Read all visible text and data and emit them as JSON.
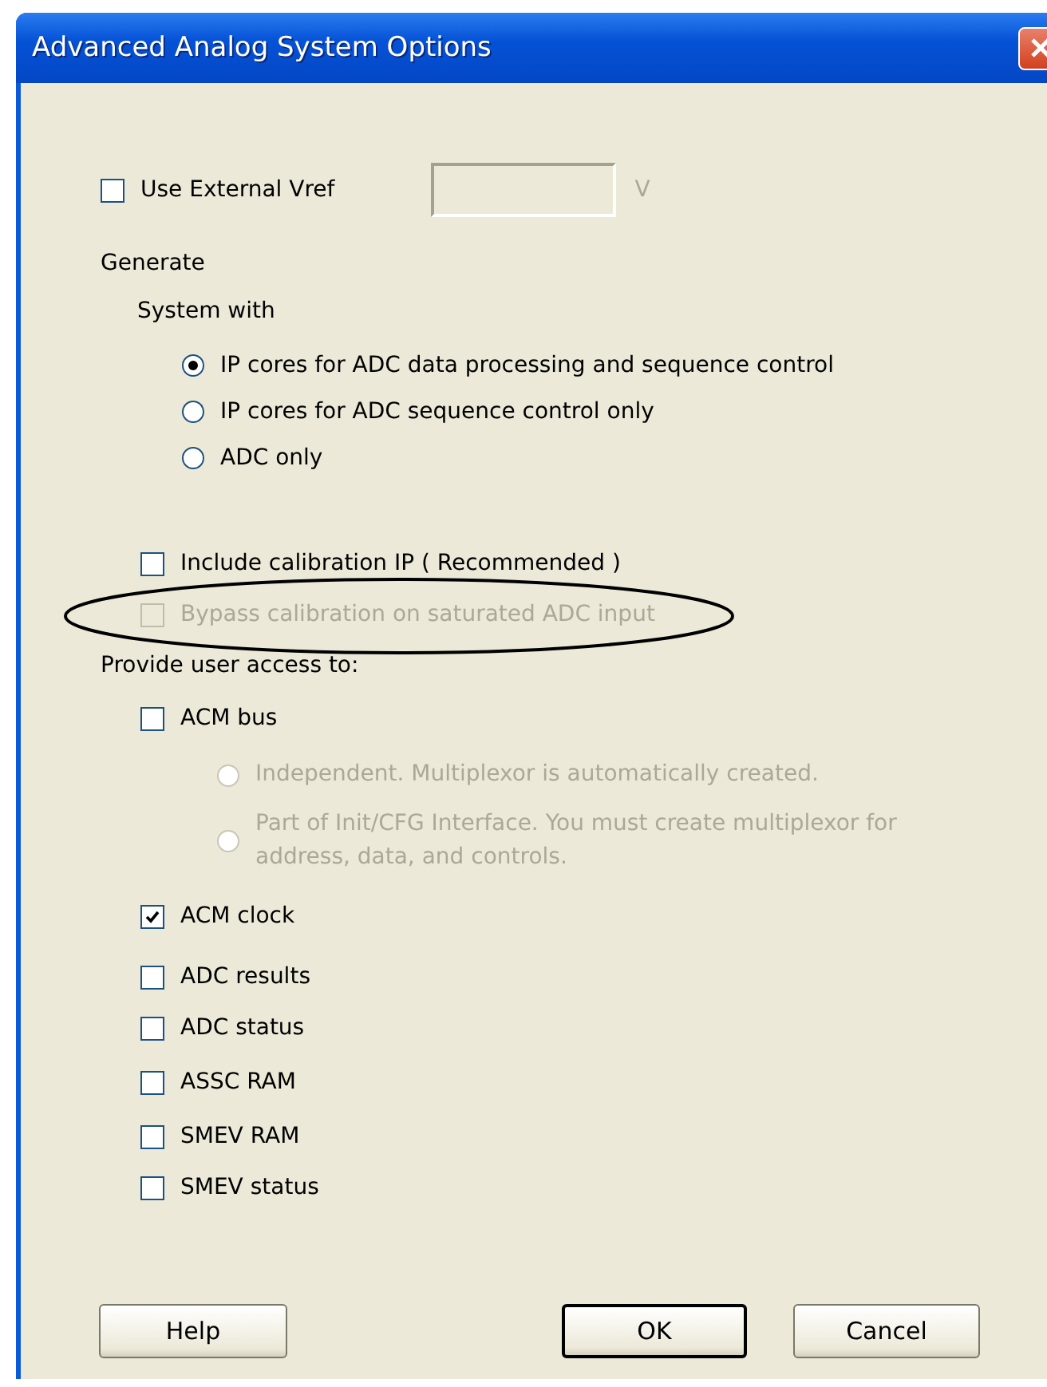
{
  "window": {
    "title": "Advanced Analog System Options"
  },
  "external_vref": {
    "label": "Use External Vref",
    "checked": false,
    "unit": "V",
    "disabled_field": true
  },
  "generate": {
    "label": "Generate",
    "system_with": {
      "label": "System with",
      "options": [
        {
          "label": "IP cores for ADC data processing and sequence control",
          "selected": true
        },
        {
          "label": "IP cores for ADC sequence control only",
          "selected": false
        },
        {
          "label": "ADC only",
          "selected": false
        }
      ]
    }
  },
  "calibration": {
    "label": "Include calibration IP ( Recommended )",
    "checked": false,
    "children": [
      {
        "label": "Bypass calibration on saturated ADC input",
        "checked": false,
        "disabled": true,
        "highlighted": true
      }
    ]
  },
  "user_access": {
    "label": "Provide user access to:",
    "groups": [
      [
        {
          "label": "ACM bus",
          "checked": false,
          "children": [
            {
              "label": "Independent. Multiplexor is automatically created.",
              "selected": false,
              "disabled": true
            },
            {
              "label": "Part of Init/CFG Interface. You must create multiplexor for address, data, and controls.",
              "selected": false,
              "disabled": true
            }
          ]
        }
      ],
      [
        {
          "label": "ACM clock",
          "checked": true
        }
      ],
      [
        {
          "label": "ADC results",
          "checked": false
        },
        {
          "label": "ADC status",
          "checked": false
        }
      ],
      [
        {
          "label": "ASSC RAM",
          "checked": false
        }
      ],
      [
        {
          "label": "SMEV RAM",
          "checked": false
        },
        {
          "label": "SMEV status",
          "checked": false
        }
      ]
    ]
  },
  "buttons": [
    {
      "label": "Help",
      "default": false
    },
    {
      "label": "OK",
      "default": true
    },
    {
      "label": "Cancel",
      "default": false
    }
  ]
}
